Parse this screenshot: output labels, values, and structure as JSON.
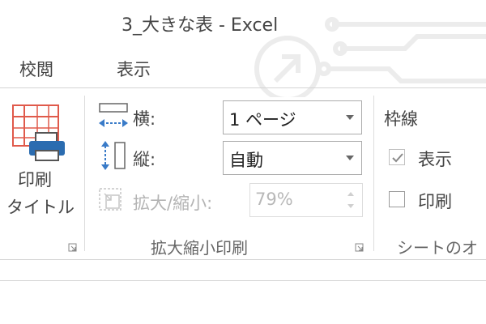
{
  "window": {
    "title": "3_大きな表 - Excel"
  },
  "tabs": [
    {
      "label": "校閲"
    },
    {
      "label": "表示"
    }
  ],
  "print_titles": {
    "line1": "印刷",
    "line2": "タイトル"
  },
  "scale_to_fit": {
    "width_label": "横:",
    "width_value": "1 ページ",
    "height_label": "縦:",
    "height_value": "自動",
    "scale_label": "拡大/縮小:",
    "scale_value": "79%",
    "group_label": "拡大縮小印刷"
  },
  "sheet_options": {
    "gridlines_label": "枠線",
    "view_label": "表示",
    "view_checked": true,
    "print_label": "印刷",
    "print_checked": false,
    "group_label": "シートのオ"
  },
  "colors": {
    "accent_red": "#e05a4b",
    "printer_blue": "#2b6cb0",
    "icon_blue": "#3a7bc8"
  },
  "icons": [
    "watermark-circuit-icon",
    "print-titles-icon",
    "width-arrows-icon",
    "height-arrows-icon",
    "scale-icon",
    "dialog-launcher-icon",
    "checkmark-icon"
  ]
}
